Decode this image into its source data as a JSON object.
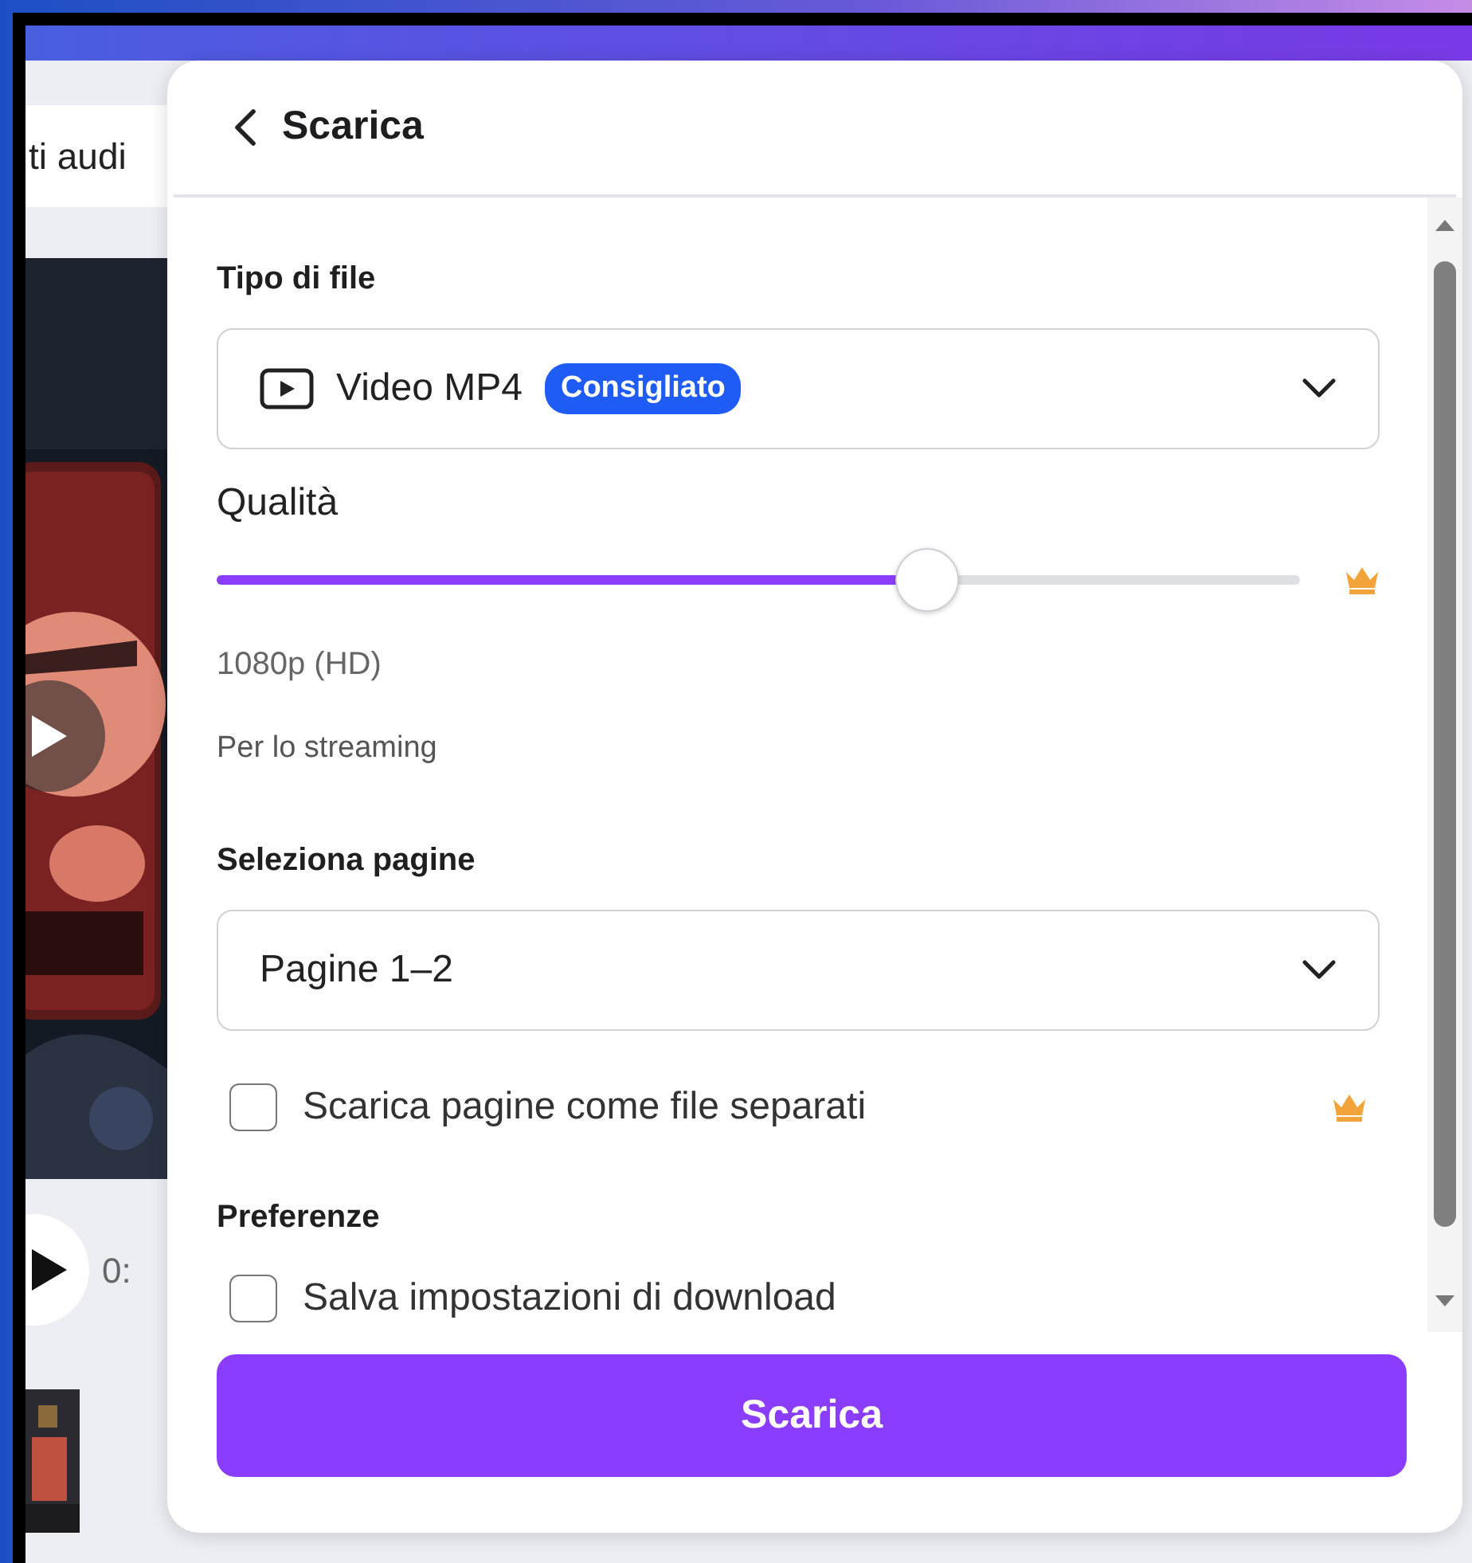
{
  "background": {
    "tab_label": "ti audi",
    "player_time": "0:"
  },
  "panel": {
    "title": "Scarica",
    "file_type": {
      "label": "Tipo di file",
      "value": "Video MP4",
      "badge": "Consigliato"
    },
    "quality": {
      "label": "Qualità",
      "level": 0.656,
      "premium": true,
      "reading": "1080p (HD)",
      "hint": "Per lo streaming"
    },
    "pages": {
      "label": "Seleziona pagine",
      "value": "Pagine 1–2"
    },
    "options": [
      {
        "kind": "checkbox",
        "label": "Scarica pagine come file separati",
        "checked": false,
        "premium": true
      }
    ],
    "preferences": {
      "label": "Preferenze",
      "options": [
        {
          "label": "Salva impostazioni di download",
          "checked": false
        }
      ]
    },
    "download_button": "Scarica"
  }
}
